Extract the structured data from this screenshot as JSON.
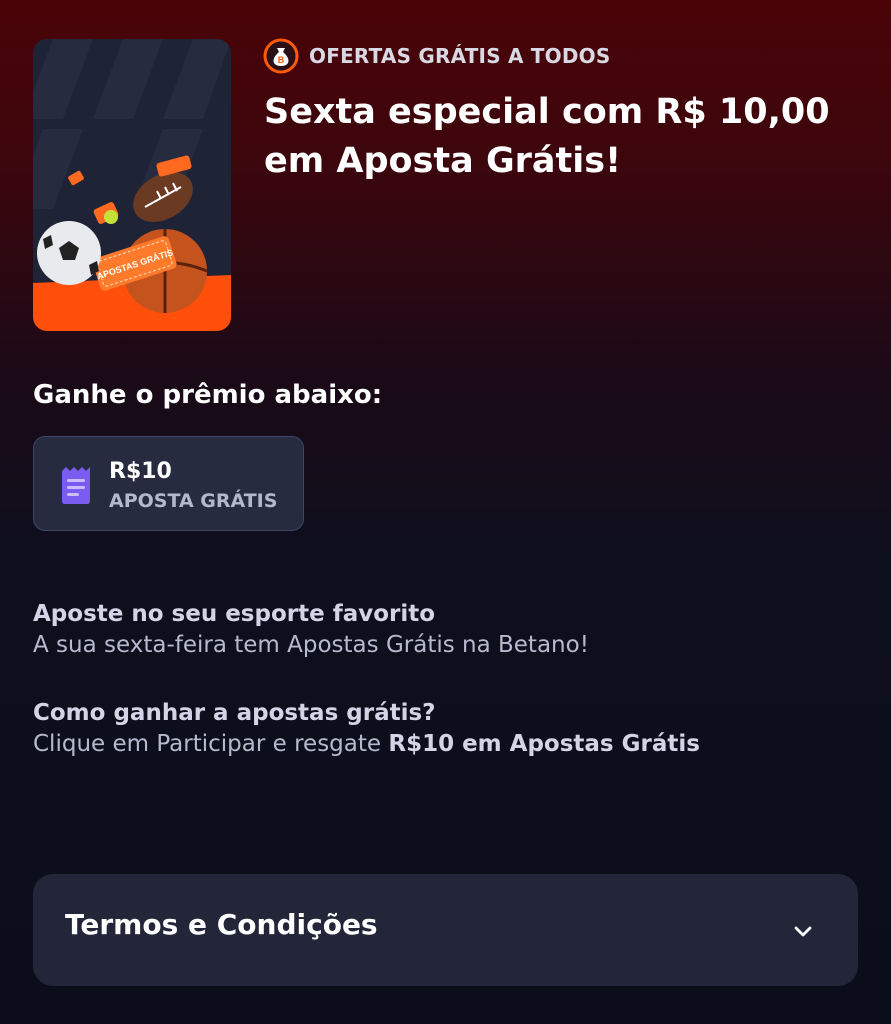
{
  "promo": {
    "badge": "OFERTAS GRÁTIS A TODOS",
    "badge_icon": "money-bag-icon",
    "title": "Sexta especial com R$ 10,00 em Aposta Grátis!",
    "image_ticket_text": "APOSTAS GRÁTIS",
    "accent_color": "#ff5a0a"
  },
  "prize": {
    "heading": "Ganhe o prêmio abaixo:",
    "amount": "R$10",
    "type": "APOSTA GRÁTIS",
    "icon": "receipt-icon",
    "icon_color": "#7b5cf0"
  },
  "info": [
    {
      "title": "Aposte no seu esporte favorito",
      "text": "A sua sexta-feira tem Apostas Grátis na Betano!"
    },
    {
      "title": "Como ganhar a apostas grátis?",
      "text_prefix": "Clique em Participar e resgate ",
      "text_bold": "R$10 em Apostas Grátis"
    }
  ],
  "terms": {
    "label": "Termos e Condições",
    "icon": "chevron-down-icon"
  }
}
